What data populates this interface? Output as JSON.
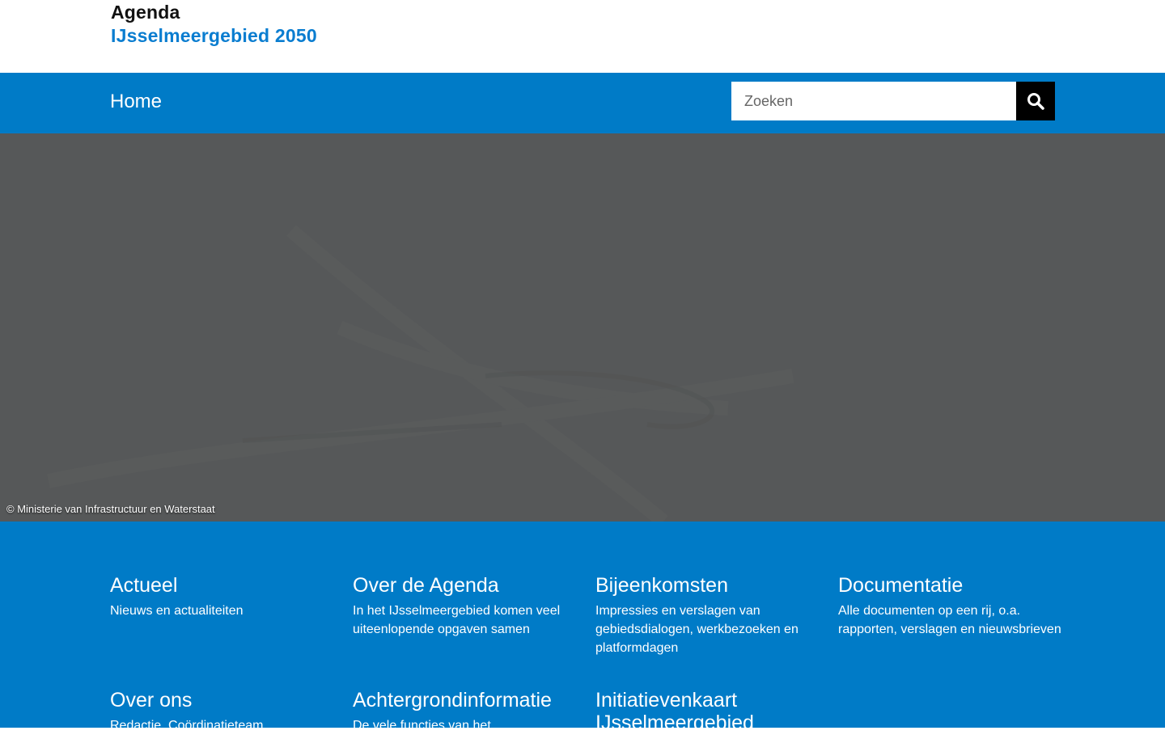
{
  "header": {
    "brand_line1": "Agenda",
    "brand_line2": "IJsselmeergebied 2050"
  },
  "nav": {
    "home_label": "Home",
    "search_placeholder": "Zoeken",
    "search_icon": "search-icon"
  },
  "hero": {
    "credit": "© Ministerie van Infrastructuur en Waterstaat"
  },
  "footer": {
    "cards": [
      {
        "title": "Actueel",
        "description": "Nieuws en actualiteiten"
      },
      {
        "title": "Over de Agenda",
        "description": "In het IJsselmeergebied komen veel uiteenlopende opgaven samen"
      },
      {
        "title": "Bijeenkomsten",
        "description": "Impressies en verslagen van gebiedsdialogen, werkbezoeken en platformdagen"
      },
      {
        "title": "Documentatie",
        "description": "Alle documenten op een rij, o.a. rapporten, verslagen en nieuwsbrieven"
      },
      {
        "title": "Over ons",
        "description": "Redactie, Coördinatieteam"
      },
      {
        "title": "Achtergrondinformatie",
        "description": "De vele functies van het"
      },
      {
        "title": "Initiatievenkaart IJsselmeergebied",
        "description": ""
      }
    ]
  },
  "colors": {
    "brand_blue": "#007bc7",
    "title_blue": "#0a7dd0",
    "hero_gray": "#575859"
  }
}
